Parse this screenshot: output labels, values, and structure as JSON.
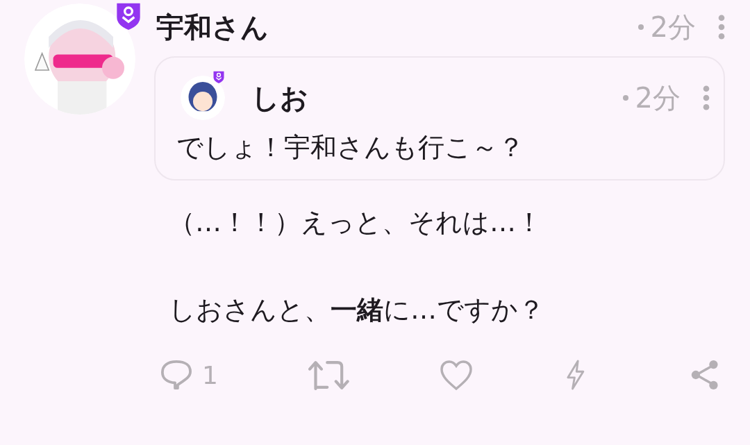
{
  "post": {
    "author": {
      "name": "宇和さん",
      "badge": true
    },
    "time": "2分",
    "quote": {
      "author": {
        "name": "しお",
        "badge": true
      },
      "time": "2分",
      "text": "でしょ！宇和さんも行こ～？"
    },
    "body": [
      "（…！！）えっと、それは…！",
      "しおさんと、**一緒**に…ですか？"
    ],
    "actions": [
      {
        "kind": "reply",
        "count": "1"
      },
      {
        "kind": "renote"
      },
      {
        "kind": "like"
      },
      {
        "kind": "react"
      },
      {
        "kind": "share"
      }
    ]
  }
}
